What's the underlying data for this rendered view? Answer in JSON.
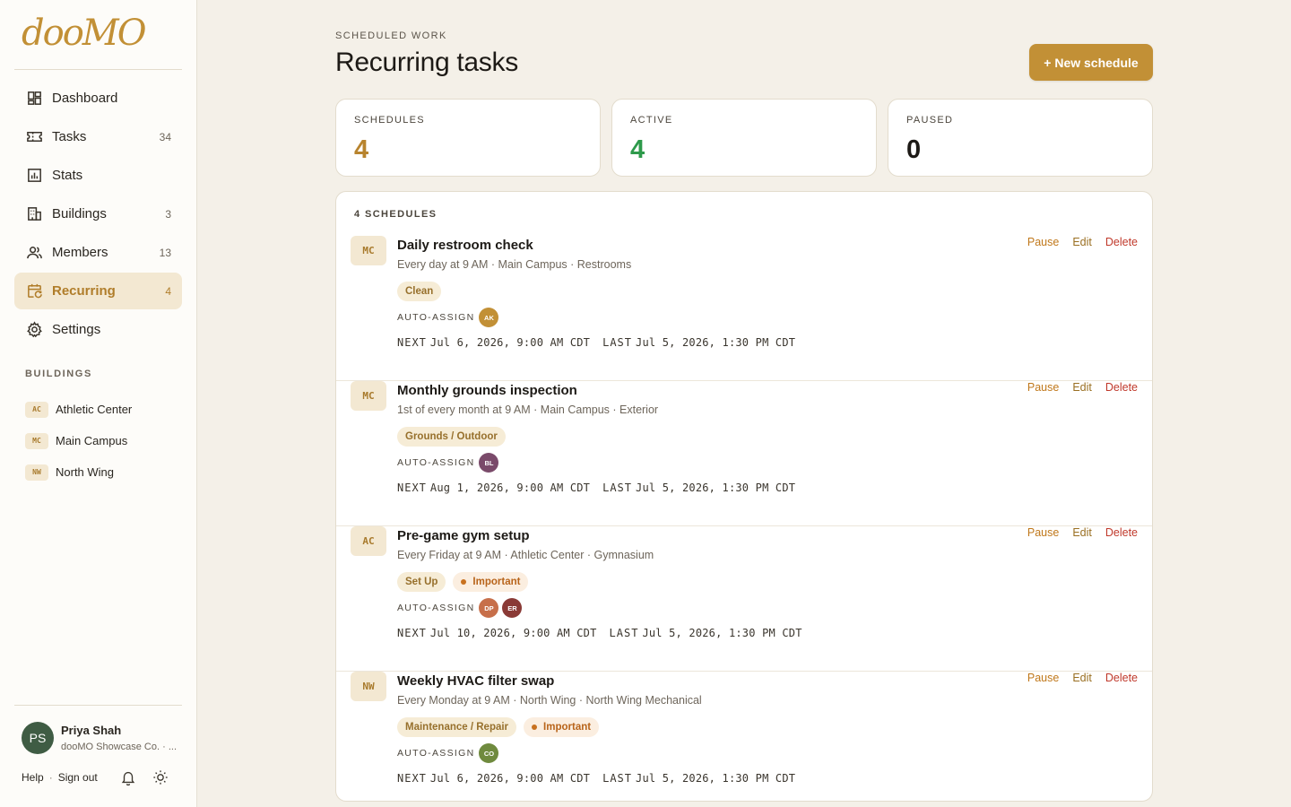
{
  "app": {
    "logo": "dooMO"
  },
  "sidebar": {
    "nav": [
      {
        "label": "Dashboard",
        "count": "",
        "icon": "dashboard-icon"
      },
      {
        "label": "Tasks",
        "count": "34",
        "icon": "ticket-icon"
      },
      {
        "label": "Stats",
        "count": "",
        "icon": "chart-icon"
      },
      {
        "label": "Buildings",
        "count": "3",
        "icon": "building-icon"
      },
      {
        "label": "Members",
        "count": "13",
        "icon": "users-icon"
      },
      {
        "label": "Recurring",
        "count": "4",
        "icon": "calendar-repeat-icon",
        "active": true
      },
      {
        "label": "Settings",
        "count": "",
        "icon": "gear-icon"
      }
    ],
    "buildings_label": "BUILDINGS",
    "buildings": [
      {
        "code": "AC",
        "name": "Athletic Center"
      },
      {
        "code": "MC",
        "name": "Main Campus"
      },
      {
        "code": "NW",
        "name": "North Wing"
      }
    ],
    "user": {
      "initials": "PS",
      "name": "Priya Shah",
      "org": "dooMO Showcase Co. · ..."
    },
    "footer": {
      "help": "Help",
      "sep": "·",
      "signout": "Sign out"
    }
  },
  "header": {
    "eyebrow": "SCHEDULED WORK",
    "title": "Recurring tasks",
    "new_button": "+ New schedule"
  },
  "stats": [
    {
      "label": "SCHEDULES",
      "value": "4",
      "color": "#b8842e"
    },
    {
      "label": "ACTIVE",
      "value": "4",
      "color": "#2e9a4b"
    },
    {
      "label": "PAUSED",
      "value": "0",
      "color": "#1d1a16"
    }
  ],
  "list": {
    "header": "4 SCHEDULES",
    "actions": {
      "pause": "Pause",
      "edit": "Edit",
      "delete": "Delete"
    },
    "auto_assign_label": "AUTO-ASSIGN",
    "next_label": "NEXT",
    "last_label": "LAST",
    "items": [
      {
        "code": "MC",
        "title": "Daily restroom check",
        "subtitle": "Every day at 9 AM · Main Campus · Restrooms",
        "tags": [
          {
            "label": "Clean",
            "important": false
          }
        ],
        "assignees": [
          {
            "initials": "AK",
            "color": "#c29036"
          }
        ],
        "next": "Jul 6, 2026, 9:00 AM CDT",
        "last": "Jul 5, 2026, 1:30 PM CDT"
      },
      {
        "code": "MC",
        "title": "Monthly grounds inspection",
        "subtitle": "1st of every month at 9 AM · Main Campus · Exterior",
        "tags": [
          {
            "label": "Grounds / Outdoor",
            "important": false
          }
        ],
        "assignees": [
          {
            "initials": "BL",
            "color": "#7a4a6a"
          }
        ],
        "next": "Aug 1, 2026, 9:00 AM CDT",
        "last": "Jul 5, 2026, 1:30 PM CDT"
      },
      {
        "code": "AC",
        "title": "Pre-game gym setup",
        "subtitle": "Every Friday at 9 AM · Athletic Center · Gymnasium",
        "tags": [
          {
            "label": "Set Up",
            "important": false
          },
          {
            "label": "Important",
            "important": true
          }
        ],
        "assignees": [
          {
            "initials": "DP",
            "color": "#c76f4a"
          },
          {
            "initials": "ER",
            "color": "#8a3a36"
          }
        ],
        "next": "Jul 10, 2026, 9:00 AM CDT",
        "last": "Jul 5, 2026, 1:30 PM CDT"
      },
      {
        "code": "NW",
        "title": "Weekly HVAC filter swap",
        "subtitle": "Every Monday at 9 AM · North Wing · North Wing Mechanical",
        "tags": [
          {
            "label": "Maintenance / Repair",
            "important": false
          },
          {
            "label": "Important",
            "important": true
          }
        ],
        "assignees": [
          {
            "initials": "CO",
            "color": "#6f8a3e"
          }
        ],
        "next": "Jul 6, 2026, 9:00 AM CDT",
        "last": "Jul 5, 2026, 1:30 PM CDT"
      }
    ]
  }
}
